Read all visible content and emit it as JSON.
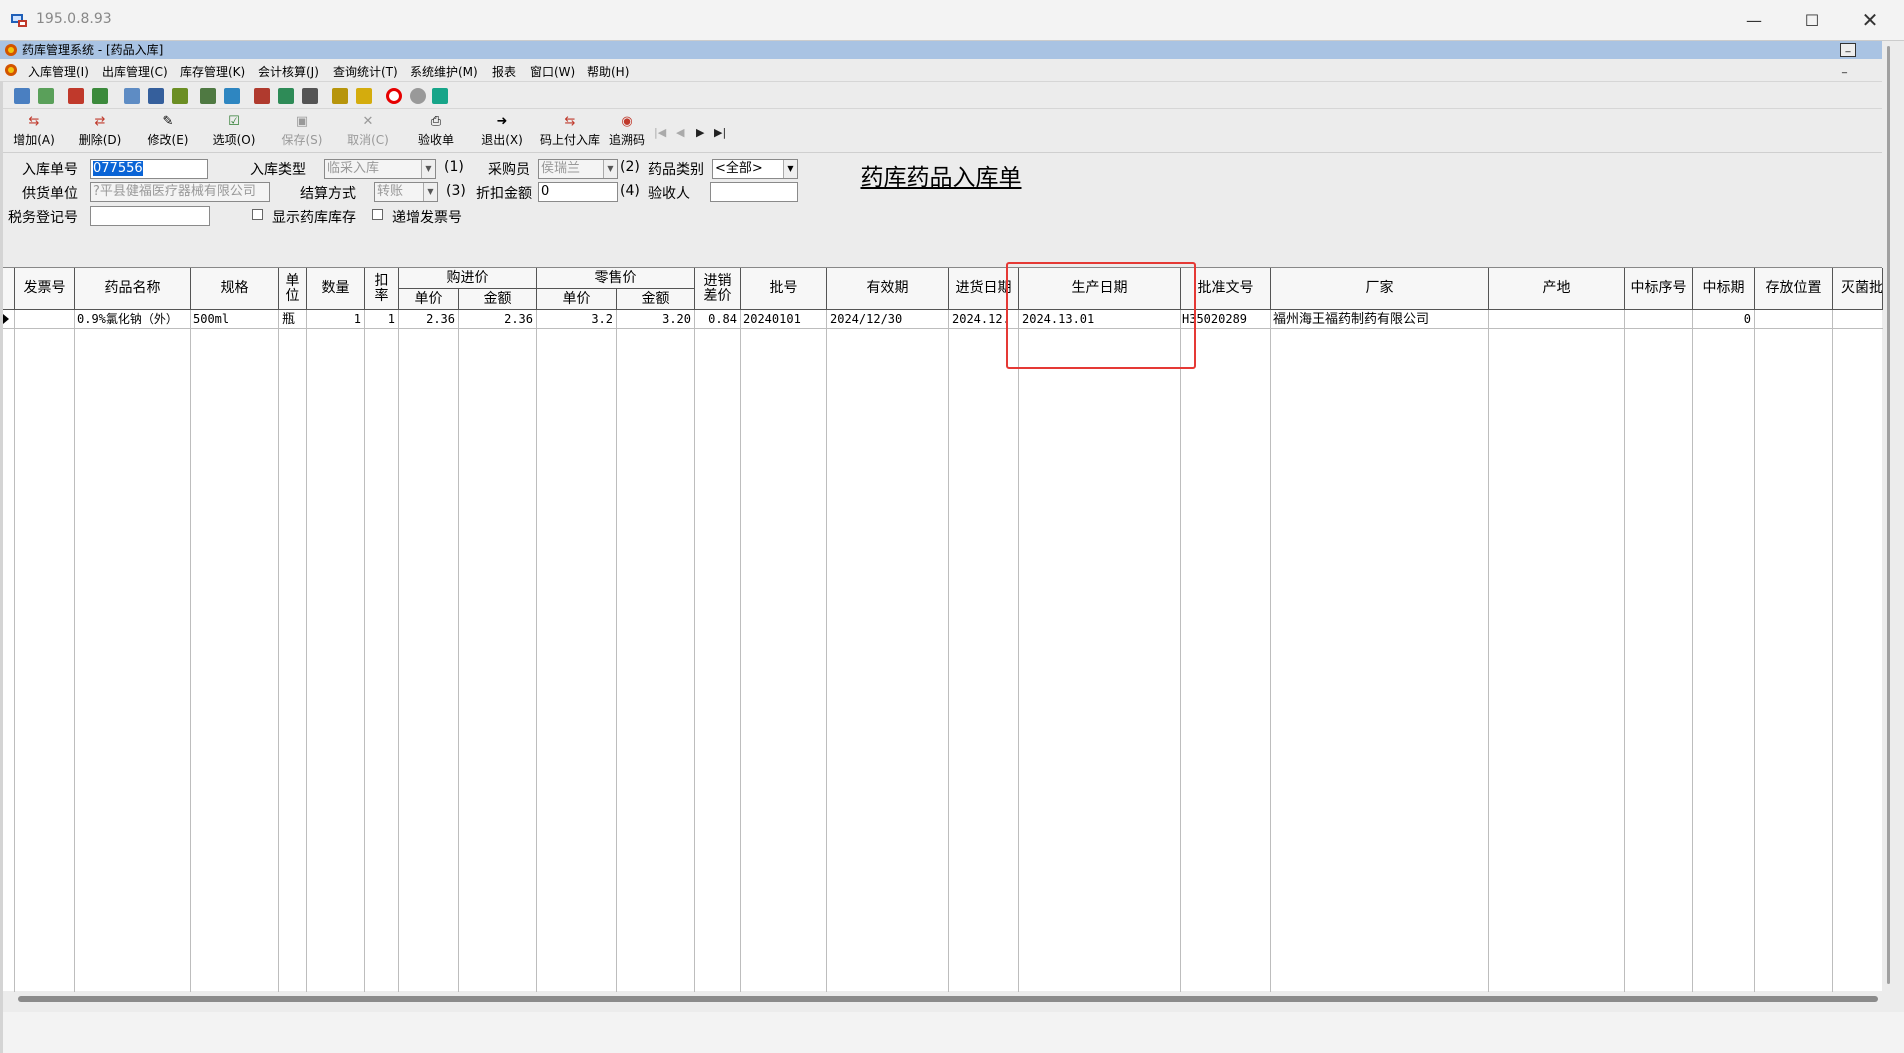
{
  "rdp": {
    "title": "195.0.8.93",
    "minimize_icon": "minimize-icon",
    "maximize_icon": "maximize-icon",
    "close_icon": "close-icon"
  },
  "app": {
    "title": "药库管理系统 - [药品入库]"
  },
  "menu": [
    "入库管理(I)",
    "出库管理(C)",
    "库存管理(K)",
    "会计核算(J)",
    "查询统计(T)",
    "系统维护(M)",
    "报表",
    "窗口(W)",
    "帮助(H)"
  ],
  "toolbar": {
    "add": "增加(A)",
    "delete": "删除(D)",
    "modify": "修改(E)",
    "options": "选项(O)",
    "save": "保存(S)",
    "cancel": "取消(C)",
    "receipt": "验收单",
    "exit": "退出(X)",
    "scan_in": "码上付入库",
    "trace": "追溯码"
  },
  "form": {
    "title": "药库药品入库单",
    "order_no_label": "入库单号",
    "order_no": "077556",
    "type_label": "入库类型",
    "type_value": "临采入库",
    "type_hint": "(1)",
    "buyer_label": "采购员",
    "buyer_value": "侯瑞兰",
    "buyer_hint": "(2)",
    "category_label": "药品类别",
    "category_value": "<全部>",
    "supplier_label": "供货单位",
    "supplier_value": "?平县健福医疗器械有限公司",
    "settle_label": "结算方式",
    "settle_value": "转账",
    "settle_hint": "(3)",
    "discount_label": "折扣金额",
    "discount_value": "0",
    "discount_hint": "(4)",
    "inspector_label": "验收人",
    "inspector_value": "",
    "tax_label": "税务登记号",
    "tax_value": "",
    "show_stock_label": "显示药库库存",
    "incr_invoice_label": "递增发票号"
  },
  "grid": {
    "headers": {
      "invoice": "发票号",
      "name": "药品名称",
      "spec": "规格",
      "unit": "单位",
      "qty": "数量",
      "rate": "扣率",
      "purchase": "购进价",
      "retail": "零售价",
      "unit_price": "单价",
      "amount": "金额",
      "diff": "进销差价",
      "batch": "批号",
      "expiry": "有效期",
      "in_date": "进货日期",
      "mfg_date": "生产日期",
      "approval": "批准文号",
      "maker": "厂家",
      "origin": "产地",
      "bid_no": "中标序号",
      "bid_period": "中标期",
      "location": "存放位置",
      "sterile": "灭菌批"
    },
    "rows": [
      {
        "invoice": "",
        "name": "0.9%氯化钠（外）",
        "spec": "500ml",
        "unit": "瓶",
        "qty": "1",
        "rate": "1",
        "p_price": "2.36",
        "p_amount": "2.36",
        "r_price": "3.2",
        "r_amount": "3.20",
        "diff": "0.84",
        "batch": "20240101",
        "expiry": "2024/12/30",
        "in_date": "2024.12.",
        "mfg_date": "2024.13.01",
        "approval": "H35020289",
        "maker": "福州海王福药制药有限公司",
        "origin": "",
        "bid_no": "",
        "bid_period": "0",
        "location": "",
        "sterile": ""
      }
    ]
  }
}
